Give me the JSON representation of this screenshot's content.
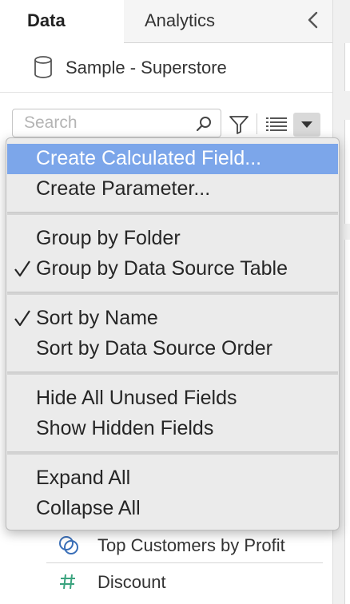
{
  "tabs": {
    "data_label": "Data",
    "analytics_label": "Analytics"
  },
  "datasource": {
    "name": "Sample - Superstore"
  },
  "search": {
    "placeholder": "Search",
    "value": ""
  },
  "menu": {
    "highlight_color": "#7ca6ea",
    "groups": [
      {
        "items": [
          {
            "label": "Create Calculated Field...",
            "checked": false,
            "highlighted": true
          },
          {
            "label": "Create Parameter...",
            "checked": false,
            "highlighted": false
          }
        ]
      },
      {
        "items": [
          {
            "label": "Group by Folder",
            "checked": false,
            "highlighted": false
          },
          {
            "label": "Group by Data Source Table",
            "checked": true,
            "highlighted": false
          }
        ]
      },
      {
        "items": [
          {
            "label": "Sort by Name",
            "checked": true,
            "highlighted": false
          },
          {
            "label": "Sort by Data Source Order",
            "checked": false,
            "highlighted": false
          }
        ]
      },
      {
        "items": [
          {
            "label": "Hide All Unused Fields",
            "checked": false,
            "highlighted": false
          },
          {
            "label": "Show Hidden Fields",
            "checked": false,
            "highlighted": false
          }
        ]
      },
      {
        "items": [
          {
            "label": "Expand All",
            "checked": false,
            "highlighted": false
          },
          {
            "label": "Collapse All",
            "checked": false,
            "highlighted": false
          }
        ]
      }
    ]
  },
  "fields": [
    {
      "label": "Top Customers by Profit",
      "icon": "set-icon",
      "color": "#3a6fb8"
    },
    {
      "label": "Discount",
      "icon": "measure-icon",
      "color": "#3aa37e"
    }
  ]
}
